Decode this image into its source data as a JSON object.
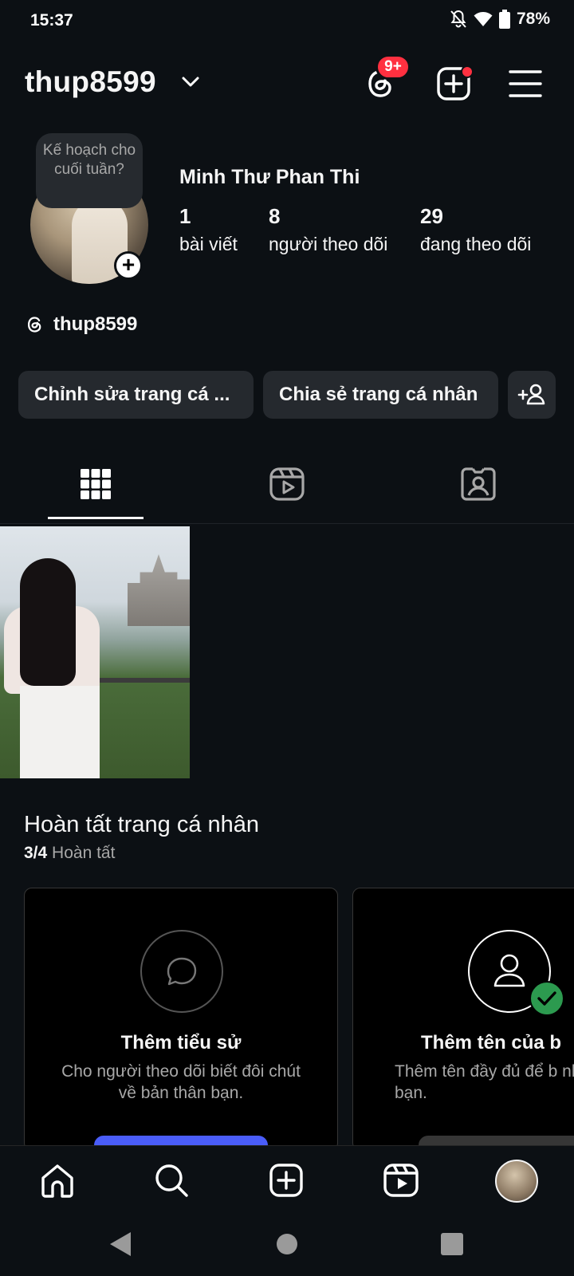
{
  "status_bar": {
    "time": "15:37",
    "battery": "78%"
  },
  "header": {
    "username": "thup8599",
    "threads_badge": "9+"
  },
  "profile": {
    "story_note": "Kế hoạch cho cuối tuần?",
    "full_name": "Minh Thư Phan Thi",
    "stats": [
      {
        "value": "1",
        "label": "bài viết"
      },
      {
        "value": "8",
        "label": "người theo dõi"
      },
      {
        "value": "29",
        "label": "đang theo dõi"
      }
    ],
    "threads_handle": "thup8599"
  },
  "actions": {
    "edit_profile": "Chỉnh sửa trang cá ...",
    "share_profile": "Chia sẻ trang cá nhân"
  },
  "complete_profile": {
    "title": "Hoàn tất trang cá nhân",
    "progress": "3/4",
    "progress_label": "Hoàn tất",
    "cards": [
      {
        "title": "Thêm tiểu sử",
        "desc": "Cho người theo dõi biết đôi chút về bản thân bạn."
      },
      {
        "title": "Thêm tên của b",
        "desc": "Thêm tên đầy đủ để b nhận ra bạn."
      }
    ]
  },
  "icons": [
    "threads-icon",
    "create-icon",
    "menu-icon",
    "grid-icon",
    "reels-icon",
    "tagged-icon",
    "home-icon",
    "search-icon",
    "reels-nav-icon",
    "back-icon",
    "home-circle-icon",
    "recents-icon"
  ],
  "colors": {
    "background": "#0c1014",
    "badge": "#ff3040",
    "button": "#25292e",
    "accent": "#4a5df9",
    "check": "#2c9a4f"
  }
}
